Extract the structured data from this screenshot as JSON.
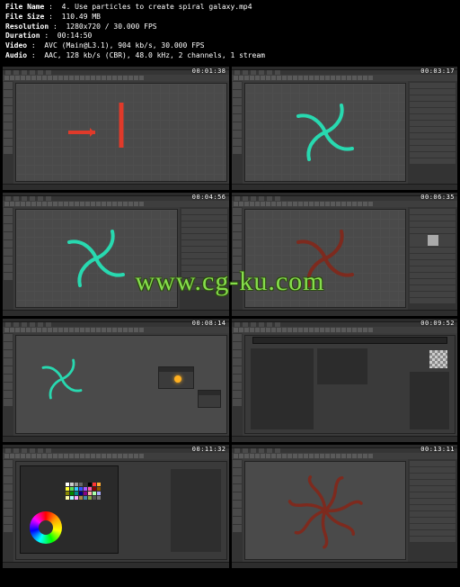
{
  "metadata": {
    "file_name_label": "File Name",
    "file_name": "4. Use particles to create spiral galaxy.mp4",
    "size_label": "File Size",
    "size": "110.49 MB",
    "resolution_label": "Resolution",
    "resolution": "1280x720 / 30.000 FPS",
    "duration_label": "Duration",
    "duration": "00:14:50",
    "video_label": "Video",
    "video": "AVC (Main@L3.1), 904 kb/s, 30.000 FPS",
    "audio_label": "Audio",
    "audio": "AAC, 128 kb/s (CBR), 48.0 kHz, 2 channels, 1 stream"
  },
  "watermark": "www.cg-ku.com",
  "thumbs": [
    {
      "tc": "00:01:38",
      "kind": "rect-arrow"
    },
    {
      "tc": "00:03:17",
      "kind": "spiral-teal-4",
      "right_panel": true
    },
    {
      "tc": "00:04:56",
      "kind": "spiral-teal-4",
      "right_panel": true
    },
    {
      "tc": "00:06:35",
      "kind": "spiral-red",
      "right_panel": true,
      "swatch": true
    },
    {
      "tc": "00:08:14",
      "kind": "node-editor"
    },
    {
      "tc": "00:09:52",
      "kind": "hypershade"
    },
    {
      "tc": "00:11:32",
      "kind": "color-picker"
    },
    {
      "tc": "00:13:11",
      "kind": "spiral-red-8",
      "right_panel": true
    }
  ],
  "colors": {
    "teal": "#28d9b0",
    "red": "#7d2a1e",
    "accent_red": "#d63a27"
  }
}
